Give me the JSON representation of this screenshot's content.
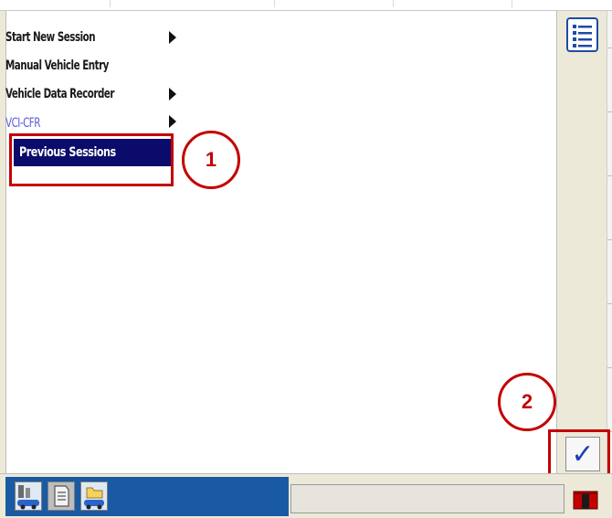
{
  "menu": {
    "items": [
      {
        "label": "Start New Session",
        "has_submenu": true
      },
      {
        "label": "Manual Vehicle Entry",
        "has_submenu": false
      },
      {
        "label": "Vehicle Data Recorder",
        "has_submenu": true
      },
      {
        "label": "VCI-CFR",
        "has_submenu": true
      }
    ],
    "selected": {
      "label": "Previous Sessions"
    }
  },
  "callouts": {
    "one": "1",
    "two": "2"
  },
  "toolbar": {
    "list_icon": "list-icon",
    "confirm_icon": "checkmark-icon",
    "confirm_glyph": "✓"
  },
  "taskbar": {
    "icons": [
      "vehicle-diagnostics-icon",
      "document-icon",
      "folder-car-icon"
    ],
    "exit_icon": "exit-icon"
  },
  "colors": {
    "highlight": "#c40000",
    "selected_bg": "#0b0b6b",
    "taskbar_bg": "#1a5aa3",
    "accent_blue": "#1c3fb8"
  }
}
